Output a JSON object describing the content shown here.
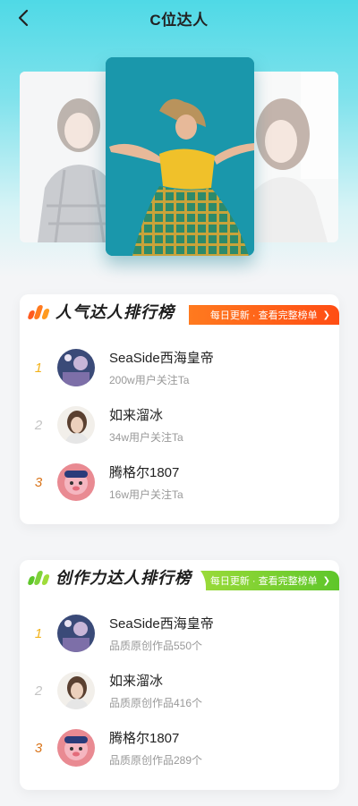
{
  "header": {
    "title": "C位达人",
    "back_icon": "chevron-left-icon"
  },
  "carousel": {
    "cards": [
      {
        "name": "carousel-card-left",
        "desc": "girl portrait plaid"
      },
      {
        "name": "carousel-card-center",
        "desc": "dancer in plaid skirt"
      },
      {
        "name": "carousel-card-right",
        "desc": "girl portrait window"
      }
    ]
  },
  "colors": {
    "orange": "#ff5a1f",
    "orange_light": "#ff9a1f",
    "green": "#5ec62a",
    "green_light": "#9fdc3a",
    "rank1": "#f2b21a",
    "rank2": "#c4c4c4",
    "rank3": "#d9741a"
  },
  "popularity": {
    "title": "人气达人排行榜",
    "ribbon": "每日更新 · 查看完整榜单",
    "items": [
      {
        "rank": "1",
        "name": "SeaSide西海皇帝",
        "meta": "200w用户关注Ta"
      },
      {
        "rank": "2",
        "name": "如来溜冰",
        "meta": "34w用户关注Ta"
      },
      {
        "rank": "3",
        "name": "腾格尔1807",
        "meta": "16w用户关注Ta"
      }
    ]
  },
  "creation": {
    "title": "创作力达人排行榜",
    "ribbon": "每日更新 · 查看完整榜单",
    "items": [
      {
        "rank": "1",
        "name": "SeaSide西海皇帝",
        "meta": "品质原创作品550个"
      },
      {
        "rank": "2",
        "name": "如来溜冰",
        "meta": "品质原创作品416个"
      },
      {
        "rank": "3",
        "name": "腾格尔1807",
        "meta": "品质原创作品289个"
      }
    ]
  }
}
